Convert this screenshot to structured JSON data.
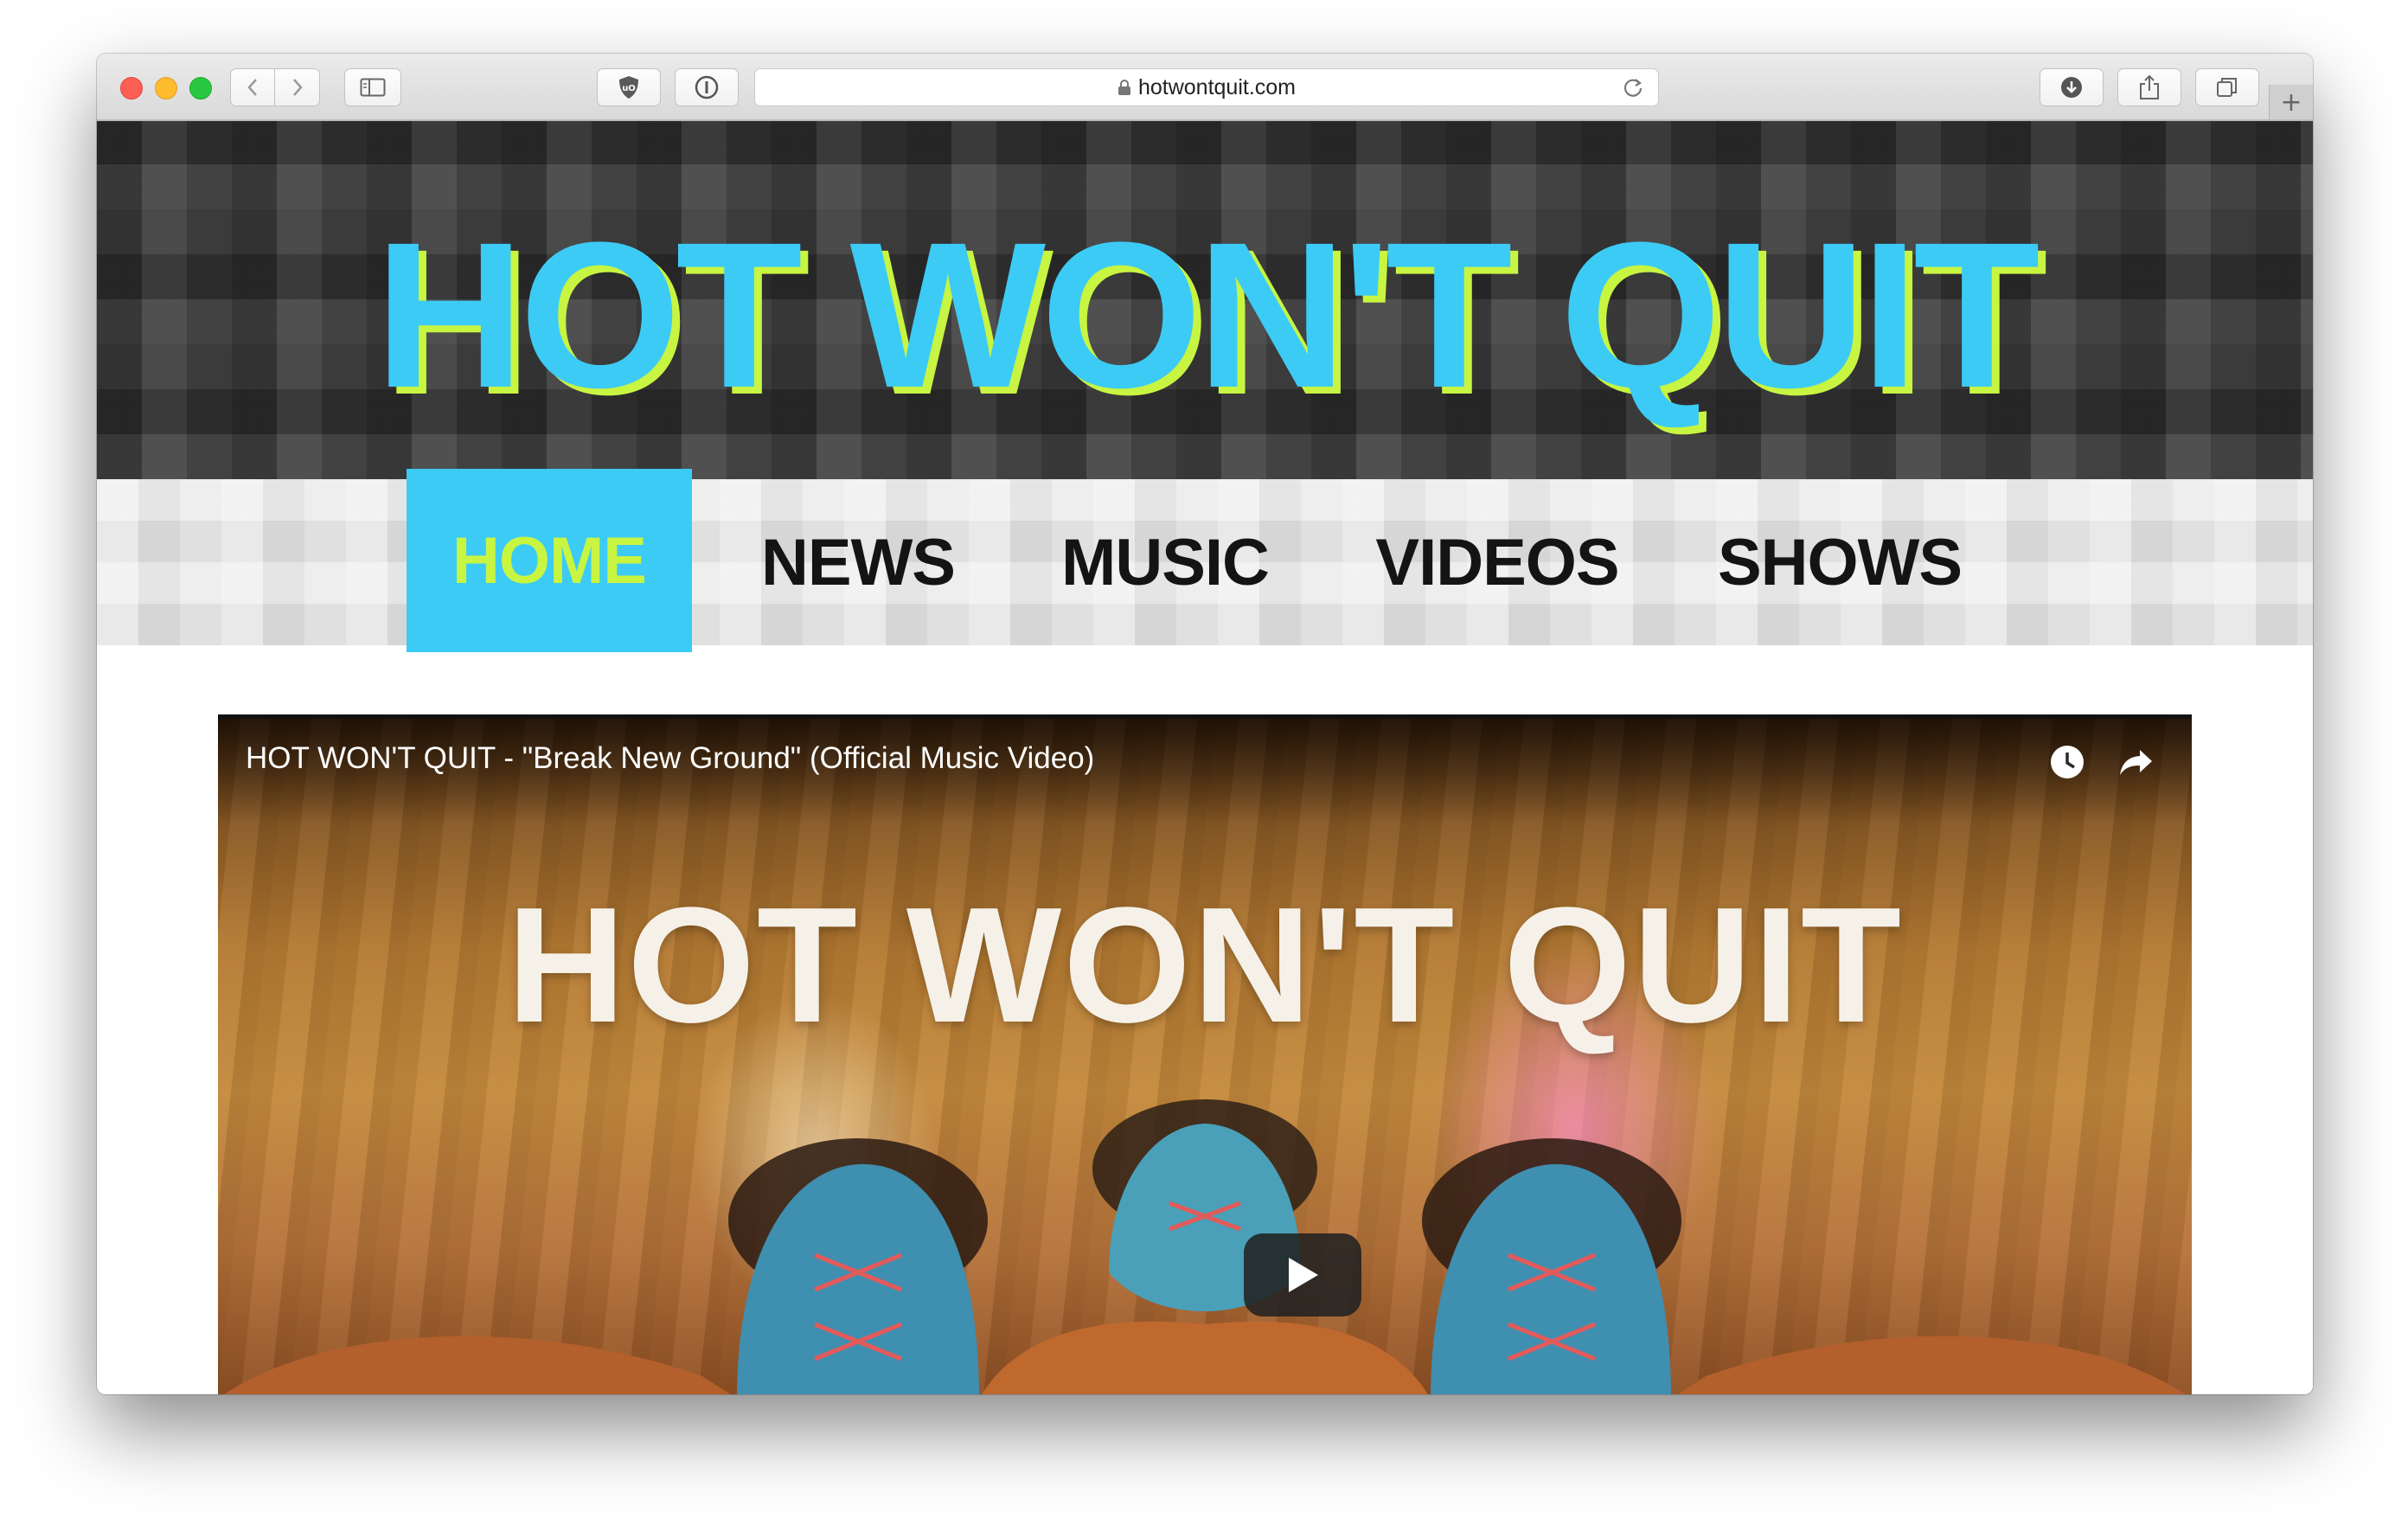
{
  "browser": {
    "url": "hotwontquit.com",
    "icons": {
      "back": "chevron-left-icon",
      "forward": "chevron-right-icon",
      "sidebar": "sidebar-icon",
      "shield": "ublock-shield-icon",
      "password": "password-icon",
      "lock": "lock-icon",
      "reload": "reload-icon",
      "downloads": "download-icon",
      "share": "share-icon",
      "tabs": "tabs-overview-icon",
      "new_tab": "plus-icon"
    },
    "new_tab_label": "+"
  },
  "site": {
    "title": "HOT WON'T QUIT",
    "colors": {
      "accent_blue": "#3ccbf5",
      "accent_green": "#c8f541",
      "nav_text": "#141414"
    },
    "nav": [
      {
        "label": "HOME",
        "active": true
      },
      {
        "label": "NEWS",
        "active": false
      },
      {
        "label": "MUSIC",
        "active": false
      },
      {
        "label": "VIDEOS",
        "active": false
      },
      {
        "label": "SHOWS",
        "active": false
      }
    ]
  },
  "video": {
    "title": "HOT WON'T QUIT - \"Break New Ground\" (Official Music Video)",
    "overlay_text": "HOT WON'T QUIT",
    "icons": {
      "watch_later": "clock-icon",
      "share": "share-arrow-icon",
      "play": "play-icon"
    }
  }
}
